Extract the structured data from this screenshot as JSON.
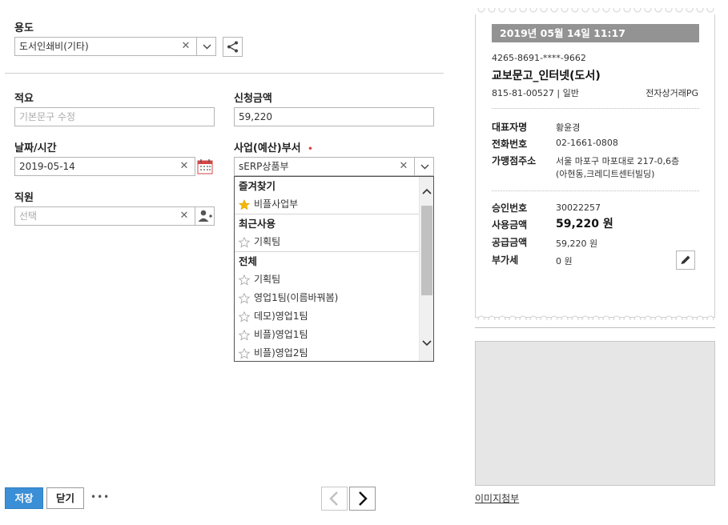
{
  "purpose": {
    "label": "용도",
    "value": "도서인쇄비(기타)"
  },
  "summary": {
    "label": "적요",
    "placeholder": "기본문구 수정"
  },
  "amount": {
    "label": "신청금액",
    "value": "59,220"
  },
  "datetime": {
    "label": "날짜/시간",
    "value": "2019-05-14"
  },
  "department": {
    "label": "사업(예산)부서",
    "required_mark": "•",
    "value": "sERP상품부"
  },
  "employee": {
    "label": "직원",
    "placeholder": "선택"
  },
  "dropdown": {
    "favorites_header": "즐겨찾기",
    "favorites": [
      "비플사업부"
    ],
    "recent_header": "최근사용",
    "recent": [
      "기획팀"
    ],
    "all_header": "전체",
    "all": [
      "기획팀",
      "영업1팀(이름바꿔봄)",
      "데모)영업1팀",
      "비플)영업1팀",
      "비플)영업2팀"
    ]
  },
  "receipt": {
    "datetime": "2019년 05월 14일 11:17",
    "card_number": "4265-8691-****-9662",
    "merchant": "교보문고_인터넷(도서)",
    "biz_number": "815-81-00527 | 일반",
    "merchant_type": "전자상거래PG",
    "rep_label": "대표자명",
    "rep_value": "황윤경",
    "phone_label": "전화번호",
    "phone_value": "02-1661-0808",
    "address_label": "가맹점주소",
    "address_line1": "서울 마포구 마포대로 217-0,6층",
    "address_line2": "(아현동,크레디트센터빌딩)",
    "approval_label": "승인번호",
    "approval_value": "30022257",
    "use_amount_label": "사용금액",
    "use_amount_value": "59,220 원",
    "supply_label": "공급금액",
    "supply_value": "59,220 원",
    "vat_label": "부가세",
    "vat_value": "0 원"
  },
  "attach_link": "이미지첨부",
  "buttons": {
    "save": "저장",
    "close": "닫기",
    "more": "•••"
  },
  "colors": {
    "primary": "#3a8fd6",
    "required": "#e0363a",
    "star_filled": "#f5b800",
    "receipt_header": "#939393"
  }
}
